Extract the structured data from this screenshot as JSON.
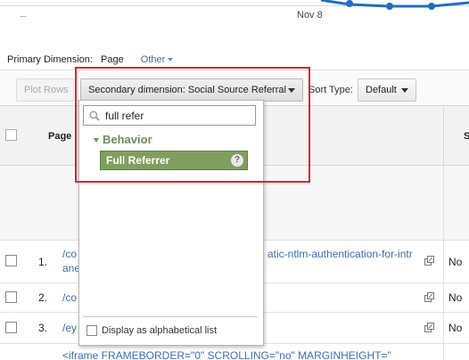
{
  "chart": {
    "x_tick_label": "Nov 8",
    "left_label": "...",
    "line_color": "#1f6fbf"
  },
  "primary_dimension": {
    "label": "Primary Dimension:",
    "value": "Page",
    "other_label": "Other"
  },
  "toolbar": {
    "plot_rows_label": "Plot Rows",
    "secondary_dimension_label": "Secondary dimension: Social Source Referral",
    "sort_type_label": "Sort Type:",
    "sort_type_value": "Default"
  },
  "table": {
    "header_page": "Page",
    "header_next": "S",
    "rows": [
      {
        "index": "1.",
        "link_line1": "/co",
        "link_line2": "ane",
        "link_tail": "atic-ntlm-authentication-for-intr",
        "value": "No"
      },
      {
        "index": "2.",
        "link_line1": "/co",
        "link_line2": "",
        "link_tail": "",
        "value": "No"
      },
      {
        "index": "3.",
        "link_line1": "/ey",
        "link_line2": "",
        "link_tail": "",
        "value": "No"
      }
    ],
    "partial_row_text": "<iframe FRAMEBORDER=\"0\" SCROLLING=\"no\" MARGINHEIGHT=\""
  },
  "dropdown": {
    "search_value": "full refer",
    "group_label": "Behavior",
    "selected_option": "Full Referrer",
    "help_glyph": "?",
    "alphabetical_label": "Display as alphabetical list"
  },
  "colors": {
    "highlight": "#e0222a",
    "selected_option_bg": "#7f9f5f",
    "link": "#3d6db5"
  }
}
